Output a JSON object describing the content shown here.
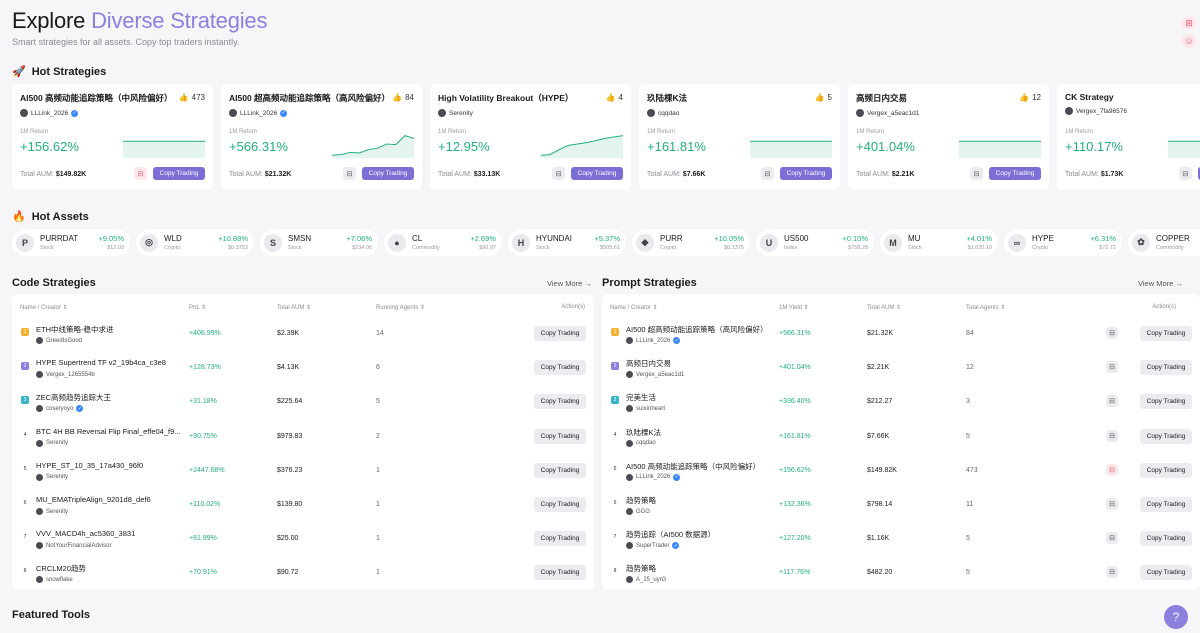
{
  "hero": {
    "title_plain": "Explore ",
    "title_accent": "Diverse Strategies",
    "subtitle": "Smart strategies for all assets. Copy top traders instantly."
  },
  "hot_strategies": {
    "title": "Hot Strategies",
    "return_label": "1M Return",
    "aum_label": "Total AUM:",
    "copy_label": "Copy Trading",
    "cards": [
      {
        "name": "AI500 高频动能追踪策略（中风险偏好）",
        "likes": "473",
        "creator": "LLLink_2026",
        "verified": true,
        "value": "+156.62%",
        "aum": "$149.82K",
        "fav_pink": true,
        "spark": [
          60,
          60,
          60,
          60,
          60,
          60,
          60,
          60,
          60,
          60
        ]
      },
      {
        "name": "AI500 超高频动能追踪策略（高风险偏好）",
        "likes": "84",
        "creator": "LLLink_2026",
        "verified": true,
        "value": "+566.31%",
        "aum": "$21.32K",
        "fav_pink": false,
        "spark": [
          10,
          12,
          20,
          18,
          30,
          35,
          50,
          48,
          80,
          70
        ]
      },
      {
        "name": "High Volatility Breakout（HYPE）",
        "likes": "4",
        "creator": "Serenity",
        "verified": false,
        "value": "+12.95%",
        "aum": "$33.13K",
        "fav_pink": false,
        "spark": [
          10,
          12,
          30,
          45,
          50,
          55,
          62,
          70,
          75,
          80
        ]
      },
      {
        "name": "玖陆棵K法",
        "likes": "5",
        "creator": "cqqdao",
        "verified": false,
        "value": "+161.81%",
        "aum": "$7.66K",
        "fav_pink": false,
        "spark": [
          60,
          60,
          60,
          60,
          60,
          60,
          60,
          60,
          60,
          60
        ]
      },
      {
        "name": "高频日内交易",
        "likes": "12",
        "creator": "Vergex_a5eac1d1",
        "verified": false,
        "value": "+401.04%",
        "aum": "$2.21K",
        "fav_pink": false,
        "spark": [
          60,
          60,
          60,
          60,
          60,
          60,
          60,
          60,
          60,
          60
        ]
      },
      {
        "name": "CK Strategy",
        "likes": "",
        "creator": "Vergex_7fa96576",
        "verified": false,
        "value": "+110.17%",
        "aum": "$1.73K",
        "fav_pink": false,
        "spark": [
          60,
          60,
          60,
          60,
          60,
          60,
          60,
          60,
          60,
          60
        ]
      }
    ]
  },
  "hot_assets": {
    "title": "Hot Assets",
    "items": [
      {
        "symbol": "PURRDAT",
        "category": "Stock",
        "change": "+9.05%",
        "price": "$12.03",
        "icon": "P"
      },
      {
        "symbol": "WLD",
        "category": "Crypto",
        "change": "+10.88%",
        "price": "$0.3753",
        "icon": "◎"
      },
      {
        "symbol": "SMSN",
        "category": "Stock",
        "change": "+7.06%",
        "price": "$234.06",
        "icon": "S"
      },
      {
        "symbol": "CL",
        "category": "Commodity",
        "change": "+2.69%",
        "price": "$90.97",
        "icon": "●"
      },
      {
        "symbol": "HYUNDAI",
        "category": "Stock",
        "change": "+5.37%",
        "price": "$505.61",
        "icon": "H"
      },
      {
        "symbol": "PURR",
        "category": "Crypto",
        "change": "+10.05%",
        "price": "$0.1375",
        "icon": "◆"
      },
      {
        "symbol": "US500",
        "category": "Index",
        "change": "+0.10%",
        "price": "$758.28",
        "icon": "U"
      },
      {
        "symbol": "MU",
        "category": "Stock",
        "change": "+4.01%",
        "price": "$1,020.10",
        "icon": "M"
      },
      {
        "symbol": "HYPE",
        "category": "Crypto",
        "change": "+6.31%",
        "price": "$72.72",
        "icon": "∞"
      },
      {
        "symbol": "COPPER",
        "category": "Commodity",
        "change": "+2",
        "price": "",
        "icon": "✿"
      }
    ]
  },
  "code_strategies": {
    "title": "Code Strategies",
    "view_more": "View More →",
    "headers": {
      "name": "Name / Creator ⇕",
      "pnl": "PnL ⇕",
      "aum": "Total AUM ⇕",
      "agents": "Running Agents ⇕",
      "action": "Action(s)"
    },
    "copy_label": "Copy Trading",
    "rows": [
      {
        "rank": "1",
        "name": "ETH中线策略-稳中求进",
        "creator": "GreedIsGood",
        "verified": false,
        "pnl": "+406.99%",
        "aum": "$2.39K",
        "agents": "14"
      },
      {
        "rank": "2",
        "name": "HYPE Supertrend TF v2_19b4ca_c3e8",
        "creator": "Vergex_1265554b",
        "verified": false,
        "pnl": "+128.73%",
        "aum": "$4.13K",
        "agents": "6"
      },
      {
        "rank": "3",
        "name": "ZEC高频趋势追踪大王",
        "creator": "coseryoyo",
        "verified": true,
        "pnl": "+31.18%",
        "aum": "$225.64",
        "agents": "5"
      },
      {
        "rank": "4",
        "name": "BTC 4H BB Reversal Flip Final_effe04_f9...",
        "creator": "Serenity",
        "verified": false,
        "pnl": "+90.75%",
        "aum": "$979.83",
        "agents": "2"
      },
      {
        "rank": "5",
        "name": "HYPE_ST_10_35_17a430_96f0",
        "creator": "Serenity",
        "verified": false,
        "pnl": "+2447.68%",
        "aum": "$376.23",
        "agents": "1"
      },
      {
        "rank": "6",
        "name": "MU_EMATripleAlign_9201d8_def6",
        "creator": "Serenity",
        "verified": false,
        "pnl": "+110.02%",
        "aum": "$139.80",
        "agents": "1"
      },
      {
        "rank": "7",
        "name": "VVV_MACD4h_ac5360_3831",
        "creator": "NotYourFinancialAdvisor",
        "verified": false,
        "pnl": "+81.99%",
        "aum": "$25.00",
        "agents": "1"
      },
      {
        "rank": "8",
        "name": "CRCLM20趋势",
        "creator": "snowflake",
        "verified": false,
        "pnl": "+70.91%",
        "aum": "$90.72",
        "agents": "1"
      }
    ]
  },
  "prompt_strategies": {
    "title": "Prompt Strategies",
    "view_more": "View More →",
    "headers": {
      "name": "Name / Creator ⇕",
      "yield": "1M Yield ⇕",
      "aum": "Total AUM ⇕",
      "agents": "Total Agents ⇕",
      "action": "Action(s)"
    },
    "copy_label": "Copy Trading",
    "rows": [
      {
        "rank": "1",
        "name": "AI500 超高频动能追踪策略（高风险偏好）",
        "creator": "LLLink_2026",
        "verified": true,
        "yield": "+566.31%",
        "aum": "$21.32K",
        "agents": "84",
        "fav_pink": false
      },
      {
        "rank": "2",
        "name": "高频日内交易",
        "creator": "Vergex_a5eac1d1",
        "verified": false,
        "yield": "+401.04%",
        "aum": "$2.21K",
        "agents": "12",
        "fav_pink": false
      },
      {
        "rank": "3",
        "name": "完美生活",
        "creator": "suixinheart",
        "verified": false,
        "yield": "+336.40%",
        "aum": "$212.27",
        "agents": "3",
        "fav_pink": false
      },
      {
        "rank": "4",
        "name": "玖陆棵K法",
        "creator": "cqqdao",
        "verified": false,
        "yield": "+161.81%",
        "aum": "$7.66K",
        "agents": "5",
        "fav_pink": false
      },
      {
        "rank": "5",
        "name": "AI500 高频动能追踪策略（中风险偏好）",
        "creator": "LLLink_2026",
        "verified": true,
        "yield": "+156.62%",
        "aum": "$149.82K",
        "agents": "473",
        "fav_pink": true
      },
      {
        "rank": "6",
        "name": "趋势策略",
        "creator": "GGG",
        "verified": false,
        "yield": "+132.36%",
        "aum": "$798.14",
        "agents": "11",
        "fav_pink": false
      },
      {
        "rank": "7",
        "name": "趋势追踪（AI500 数据源）",
        "creator": "SuperTrader",
        "verified": true,
        "yield": "+127.20%",
        "aum": "$1.16K",
        "agents": "5",
        "fav_pink": false
      },
      {
        "rank": "8",
        "name": "趋势策略",
        "creator": "A_25_uyrG",
        "verified": false,
        "yield": "+117.76%",
        "aum": "$482.20",
        "agents": "5",
        "fav_pink": false
      }
    ]
  },
  "featured_tools": {
    "title": "Featured Tools"
  },
  "colors": {
    "accent": "#8b7fe0",
    "positive": "#22b07d",
    "copy_button": "#7b6fd6",
    "rank_1": "#f2b233",
    "rank_2": "#8b7fe0",
    "rank_3": "#33b5c7"
  }
}
